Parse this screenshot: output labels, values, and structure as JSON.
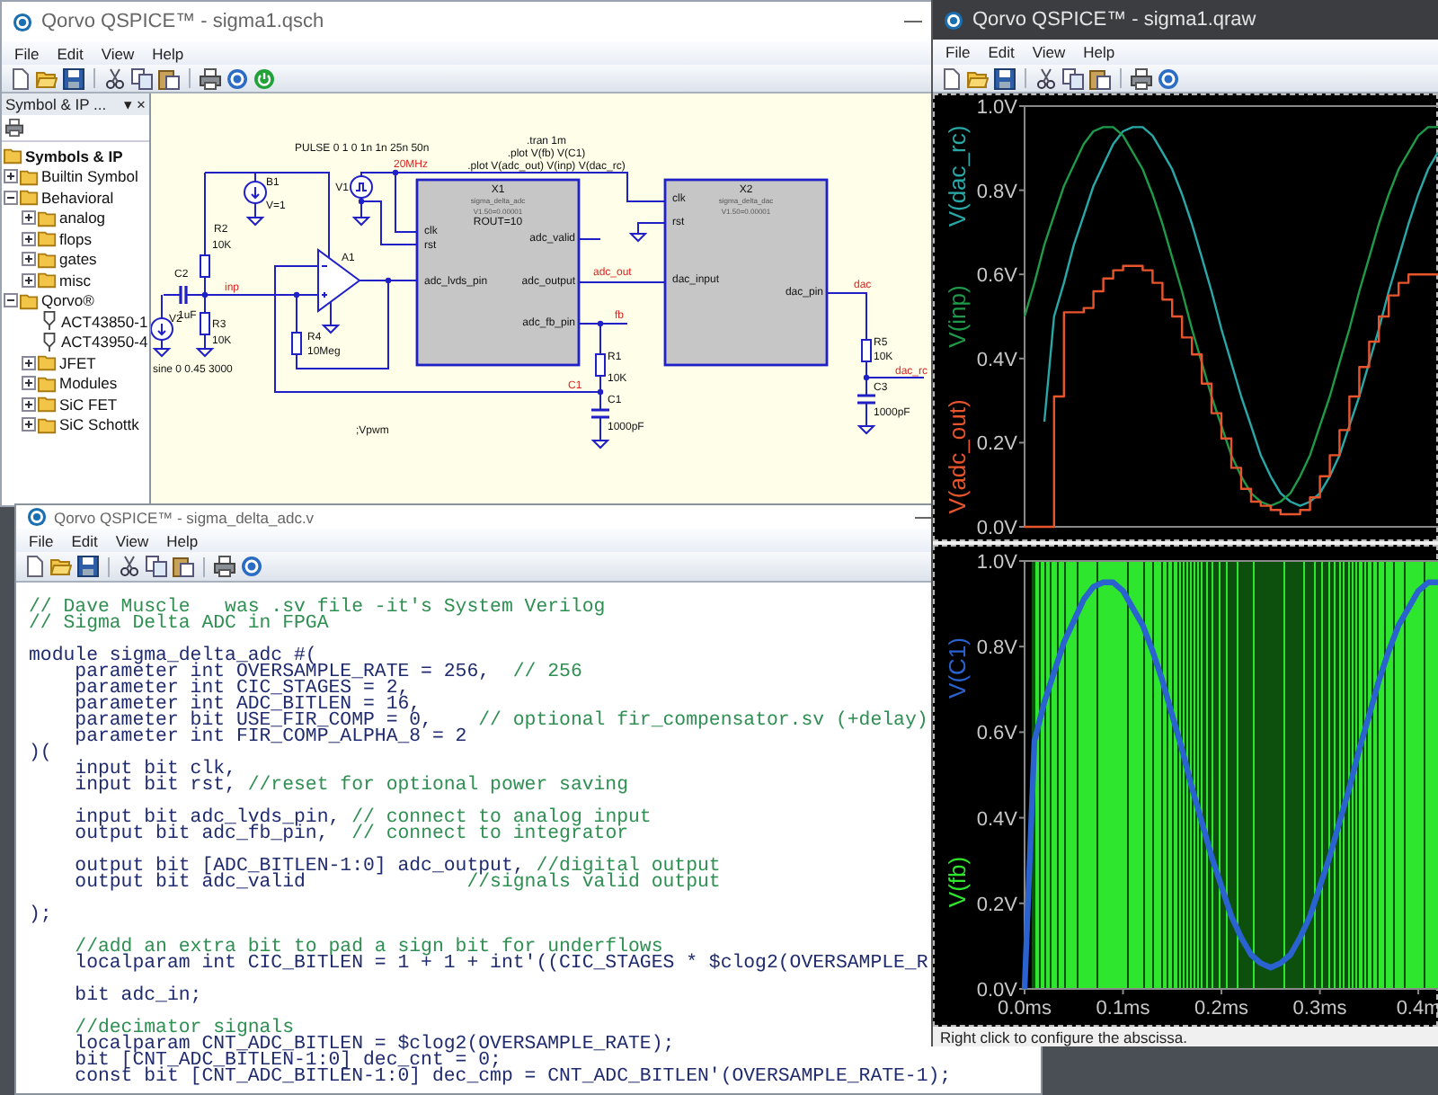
{
  "schematic_window": {
    "title": "Qorvo QSPICE™ - sigma1.qsch",
    "menu": [
      "File",
      "Edit",
      "View",
      "Help"
    ],
    "symbol_panel": {
      "title": "Symbol & IP ...",
      "pin": "▾",
      "close": "×",
      "tree": [
        {
          "label": "Symbols & IP",
          "kind": "folder",
          "children": [
            {
              "label": "Builtin Symbol",
              "kind": "folder",
              "expanded": false
            },
            {
              "label": "Behavioral",
              "kind": "folder",
              "expanded": true,
              "children": [
                {
                  "label": "analog",
                  "kind": "folder",
                  "expanded": false
                },
                {
                  "label": "flops",
                  "kind": "folder",
                  "expanded": false
                },
                {
                  "label": "gates",
                  "kind": "folder",
                  "expanded": false
                },
                {
                  "label": "misc",
                  "kind": "folder",
                  "expanded": false
                }
              ]
            },
            {
              "label": "Qorvo®",
              "kind": "folder",
              "expanded": true,
              "children": [
                {
                  "label": "ACT43850-1",
                  "kind": "symbol"
                },
                {
                  "label": "ACT43950-4",
                  "kind": "symbol"
                },
                {
                  "label": "JFET",
                  "kind": "folder",
                  "expanded": false
                },
                {
                  "label": "Modules",
                  "kind": "folder",
                  "expanded": false
                },
                {
                  "label": "SiC FET",
                  "kind": "folder",
                  "expanded": false
                },
                {
                  "label": "SiC Schottk",
                  "kind": "folder",
                  "expanded": false
                }
              ]
            }
          ]
        }
      ]
    },
    "schematic": {
      "directives": [
        ".tran 1m",
        ".plot V(fb) V(C1)",
        ".plot V(adc_out) V(inp) V(dac_rc)",
        "PULSE 0 1 0 1n 1n 25n 50n",
        "sine 0 0.45 3000",
        ";Vpwm"
      ],
      "components": [
        {
          "ref": "B1",
          "kind": "source",
          "value": "V=1"
        },
        {
          "ref": "V1",
          "kind": "pulse_source"
        },
        {
          "ref": "R2",
          "kind": "resistor",
          "value": "10K"
        },
        {
          "ref": "C2",
          "kind": "capacitor",
          "value": "1uF"
        },
        {
          "ref": "R3",
          "kind": "resistor",
          "value": "10K"
        },
        {
          "ref": "V2",
          "kind": "source"
        },
        {
          "ref": "R4",
          "kind": "resistor",
          "value": "10Meg"
        },
        {
          "ref": "A1",
          "kind": "opamp"
        },
        {
          "ref": "R1",
          "kind": "resistor",
          "value": "10K"
        },
        {
          "ref": "C1",
          "kind": "capacitor",
          "value": "1000pF"
        },
        {
          "ref": "R5",
          "kind": "resistor",
          "value": "10K"
        },
        {
          "ref": "C3",
          "kind": "capacitor",
          "value": "1000pF"
        }
      ],
      "nets": [
        "20MHz",
        "inp",
        "adc_out",
        "fb",
        "C1",
        "dac",
        "dac_rc"
      ],
      "blocks": [
        {
          "ref": "X1",
          "model": "sigma_delta_adc",
          "params": [
            "V1.50=0.00001",
            "ROUT=10"
          ],
          "left_pins": [
            "clk",
            "rst",
            "adc_lvds_pin"
          ],
          "right_pins": [
            "adc_valid",
            "adc_output",
            "adc_fb_pin"
          ]
        },
        {
          "ref": "X2",
          "model": "sigma_delta_dac",
          "params": [
            "V1.50=0.00001"
          ],
          "left_pins": [
            "clk",
            "rst",
            "dac_input"
          ],
          "right_pins": [
            "dac_pin"
          ]
        }
      ]
    }
  },
  "code_window": {
    "title": "Qorvo QSPICE™ - sigma_delta_adc.v",
    "menu": [
      "File",
      "Edit",
      "View",
      "Help"
    ],
    "lines": [
      {
        "kind": "text",
        "comment": "// Dave Muscle   was .sv file -it's System Verilog"
      },
      {
        "kind": "text",
        "comment": "// Sigma Delta ADC in FPGA"
      },
      {
        "kind": "blank"
      },
      {
        "kind": "text",
        "code": "module sigma_delta_adc #("
      },
      {
        "kind": "text",
        "code": "    parameter int OVERSAMPLE_RATE = 256,  ",
        "comment": "// 256"
      },
      {
        "kind": "text",
        "code": "    parameter int CIC_STAGES = 2,"
      },
      {
        "kind": "text",
        "code": "    parameter int ADC_BITLEN = 16,"
      },
      {
        "kind": "text",
        "code": "    parameter bit USE_FIR_COMP = 0,    ",
        "comment": "// optional fir_compensator.sv (+delay)"
      },
      {
        "kind": "text",
        "code": "    parameter int FIR_COMP_ALPHA_8 = 2"
      },
      {
        "kind": "text",
        "code": ")("
      },
      {
        "kind": "text",
        "code": "    input bit clk,"
      },
      {
        "kind": "text",
        "code": "    input bit rst, ",
        "comment": "//reset for optional power saving"
      },
      {
        "kind": "blank"
      },
      {
        "kind": "text",
        "code": "    input bit adc_lvds_pin, ",
        "comment": "// connect to analog input"
      },
      {
        "kind": "text",
        "code": "    output bit adc_fb_pin,  ",
        "comment": "// connect to integrator"
      },
      {
        "kind": "blank"
      },
      {
        "kind": "text",
        "code": "    output bit [ADC_BITLEN-1:0] adc_output, ",
        "comment": "//digital output"
      },
      {
        "kind": "text",
        "code": "    output bit adc_valid              ",
        "comment": "//signals valid output"
      },
      {
        "kind": "blank"
      },
      {
        "kind": "text",
        "code": ");"
      },
      {
        "kind": "blank"
      },
      {
        "kind": "text",
        "comment": "    //add an extra bit to pad a sign bit for underflows"
      },
      {
        "kind": "text",
        "code": "    localparam int CIC_BITLEN = 1 + 1 + int'((CIC_STAGES * $clog2(OVERSAMPLE_R"
      },
      {
        "kind": "blank"
      },
      {
        "kind": "text",
        "code": "    bit adc_in;"
      },
      {
        "kind": "blank"
      },
      {
        "kind": "text",
        "comment": "    //decimator signals"
      },
      {
        "kind": "text",
        "code": "    localparam CNT_ADC_BITLEN = $clog2(OVERSAMPLE_RATE);"
      },
      {
        "kind": "text",
        "code": "    bit [CNT_ADC_BITLEN-1:0] dec_cnt = 0;"
      },
      {
        "kind": "text",
        "code": "    const bit [CNT_ADC_BITLEN-1:0] dec_cmp = CNT_ADC_BITLEN'(OVERSAMPLE_RATE-1);"
      }
    ]
  },
  "waveform_window": {
    "title": "Qorvo QSPICE™ - sigma1.qraw",
    "menu": [
      "File",
      "Edit",
      "View",
      "Help"
    ],
    "panes": [
      {
        "chart_data": {
          "type": "line",
          "x": [
            0,
            0.01,
            0.01,
            0.02,
            0.02,
            0.03,
            0.03,
            0.04,
            0.04,
            0.05,
            0.05,
            0.06,
            0.06,
            0.07,
            0.07,
            0.08,
            0.08,
            0.09,
            0.09,
            0.1,
            0.1,
            0.11,
            0.11,
            0.12,
            0.12,
            0.13,
            0.13,
            0.14,
            0.14,
            0.15,
            0.15,
            0.16,
            0.16,
            0.17,
            0.17,
            0.18,
            0.18,
            0.19,
            0.19,
            0.2,
            0.2,
            0.21,
            0.21,
            0.22,
            0.22,
            0.23,
            0.23,
            0.24,
            0.24,
            0.25,
            0.25,
            0.26,
            0.26,
            0.27,
            0.27,
            0.28,
            0.28,
            0.29,
            0.29,
            0.3,
            0.3,
            0.31,
            0.31,
            0.32,
            0.32,
            0.33,
            0.33,
            0.34,
            0.34,
            0.35,
            0.35,
            0.36,
            0.36,
            0.37,
            0.37,
            0.38,
            0.38,
            0.39,
            0.39,
            0.4,
            0.4,
            0.41,
            0.41,
            0.42,
            0.42
          ],
          "series": [
            {
              "name": "V(dac_rc)",
              "color": "#2aa8a8",
              "values": [
                null,
                null,
                null,
                0.25,
                0.25,
                0.5,
                0.5,
                0.58,
                0.58,
                0.67,
                0.67,
                0.74,
                0.74,
                0.81,
                0.81,
                0.86,
                0.86,
                0.91,
                0.91,
                0.94,
                0.94,
                0.95,
                0.95,
                0.95,
                0.95,
                0.93,
                0.93,
                0.89,
                0.89,
                0.85,
                0.85,
                0.79,
                0.79,
                0.72,
                0.72,
                0.64,
                0.64,
                0.56,
                0.56,
                0.47,
                0.47,
                0.39,
                0.39,
                0.31,
                0.31,
                0.24,
                0.24,
                0.17,
                0.17,
                0.12,
                0.12,
                0.08,
                0.08,
                0.06,
                0.06,
                0.05,
                0.05,
                0.06,
                0.06,
                0.08,
                0.08,
                0.12,
                0.12,
                0.17,
                0.17,
                0.24,
                0.24,
                0.31,
                0.31,
                0.39,
                0.39,
                0.47,
                0.47,
                0.56,
                0.56,
                0.64,
                0.64,
                0.72,
                0.72,
                0.79,
                0.79,
                0.85,
                0.85,
                0.89,
                0.89
              ]
            },
            {
              "name": "V(inp)",
              "color": "#1e9a48",
              "values": [
                0.5,
                0.58,
                0.58,
                0.67,
                0.67,
                0.74,
                0.74,
                0.81,
                0.81,
                0.86,
                0.86,
                0.91,
                0.91,
                0.94,
                0.94,
                0.95,
                0.95,
                0.95,
                0.95,
                0.93,
                0.93,
                0.89,
                0.89,
                0.85,
                0.85,
                0.79,
                0.79,
                0.72,
                0.72,
                0.64,
                0.64,
                0.56,
                0.56,
                0.47,
                0.47,
                0.39,
                0.39,
                0.31,
                0.31,
                0.24,
                0.24,
                0.17,
                0.17,
                0.12,
                0.12,
                0.08,
                0.08,
                0.06,
                0.06,
                0.05,
                0.05,
                0.06,
                0.06,
                0.08,
                0.08,
                0.12,
                0.12,
                0.17,
                0.17,
                0.24,
                0.24,
                0.31,
                0.31,
                0.39,
                0.39,
                0.47,
                0.47,
                0.56,
                0.56,
                0.64,
                0.64,
                0.72,
                0.72,
                0.79,
                0.79,
                0.85,
                0.85,
                0.89,
                0.89,
                0.93,
                0.93,
                0.95,
                0.95,
                0.95,
                0.95
              ]
            },
            {
              "name": "V(adc_out)",
              "color": "#e8542c",
              "values": [
                0,
                0,
                0,
                0,
                0,
                0,
                0.31,
                0.31,
                0.51,
                0.51,
                0.51,
                0.51,
                0.52,
                0.52,
                0.56,
                0.56,
                0.59,
                0.59,
                0.61,
                0.61,
                0.62,
                0.62,
                0.62,
                0.62,
                0.61,
                0.61,
                0.58,
                0.58,
                0.54,
                0.54,
                0.5,
                0.5,
                0.45,
                0.45,
                0.41,
                0.41,
                0.34,
                0.34,
                0.27,
                0.27,
                0.21,
                0.21,
                0.14,
                0.14,
                0.09,
                0.09,
                0.06,
                0.06,
                0.05,
                0.05,
                0.04,
                0.04,
                0.03,
                0.03,
                0.03,
                0.03,
                0.04,
                0.04,
                0.07,
                0.07,
                0.12,
                0.12,
                0.17,
                0.17,
                0.23,
                0.23,
                0.31,
                0.31,
                0.38,
                0.38,
                0.44,
                0.44,
                0.5,
                0.5,
                0.55,
                0.55,
                0.58,
                0.58,
                0.6,
                0.6,
                0.6,
                0.6,
                0.6,
                0.6,
                0.6
              ]
            }
          ],
          "xlim": [
            0,
            0.42
          ],
          "ylim": [
            0,
            1
          ],
          "yticks": [
            {
              "value": 0,
              "label": "0.0V"
            },
            {
              "value": 0.2,
              "label": "0.2V"
            },
            {
              "value": 0.4,
              "label": "0.4V"
            },
            {
              "value": 0.6,
              "label": "0.6V"
            },
            {
              "value": 0.8,
              "label": "0.8V"
            },
            {
              "value": 1,
              "label": "1.0V"
            }
          ]
        }
      },
      {
        "chart_data": {
          "type": "line",
          "x": [
            0,
            0.01,
            0.02,
            0.03,
            0.04,
            0.05,
            0.06,
            0.07,
            0.08,
            0.09,
            0.1,
            0.11,
            0.12,
            0.13,
            0.14,
            0.15,
            0.16,
            0.17,
            0.18,
            0.19,
            0.2,
            0.21,
            0.22,
            0.23,
            0.24,
            0.25,
            0.26,
            0.27,
            0.28,
            0.29,
            0.3,
            0.31,
            0.32,
            0.33,
            0.34,
            0.35,
            0.36,
            0.37,
            0.38,
            0.39,
            0.4,
            0.41,
            0.42
          ],
          "series": [
            {
              "name": "V(C1)",
              "color": "#2a62d0",
              "values": [
                0,
                0.58,
                0.67,
                0.74,
                0.81,
                0.86,
                0.91,
                0.94,
                0.95,
                0.95,
                0.93,
                0.89,
                0.85,
                0.79,
                0.72,
                0.64,
                0.56,
                0.47,
                0.39,
                0.31,
                0.24,
                0.17,
                0.12,
                0.08,
                0.06,
                0.05,
                0.06,
                0.08,
                0.12,
                0.17,
                0.24,
                0.31,
                0.39,
                0.47,
                0.56,
                0.64,
                0.72,
                0.79,
                0.85,
                0.89,
                0.93,
                0.95,
                0.95
              ]
            }
          ],
          "xlim": [
            0,
            0.42
          ],
          "ylim": [
            0,
            1
          ],
          "xticks": [
            {
              "value": 0,
              "label": "0.0ms"
            },
            {
              "value": 0.1,
              "label": "0.1ms"
            },
            {
              "value": 0.2,
              "label": "0.2ms"
            },
            {
              "value": 0.3,
              "label": "0.3ms"
            },
            {
              "value": 0.4,
              "label": "0.4m"
            }
          ],
          "yticks": [
            {
              "value": 0,
              "label": "0.0V"
            },
            {
              "value": 0.2,
              "label": "0.2V"
            },
            {
              "value": 0.4,
              "label": "0.4V"
            },
            {
              "value": 0.6,
              "label": "0.6V"
            },
            {
              "value": 0.8,
              "label": "0.8V"
            },
            {
              "value": 1,
              "label": "1.0V"
            }
          ]
        },
        "bitstream": {
          "name": "V(fb)",
          "color": "#2ee62e"
        }
      }
    ],
    "status_bar": "Right click to configure the abscissa."
  }
}
